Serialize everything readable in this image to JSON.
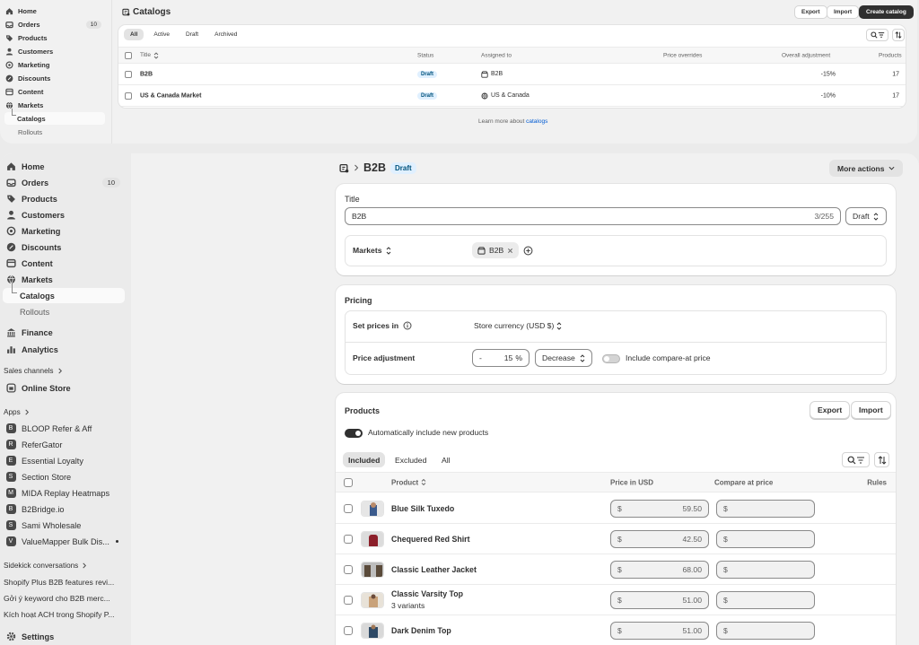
{
  "top": {
    "nav": {
      "home": "Home",
      "orders": "Orders",
      "orders_badge": "10",
      "products": "Products",
      "customers": "Customers",
      "marketing": "Marketing",
      "discounts": "Discounts",
      "content": "Content",
      "markets": "Markets",
      "catalogs": "Catalogs",
      "rollouts": "Rollouts"
    },
    "page_title": "Catalogs",
    "buttons": {
      "export": "Export",
      "import": "Import",
      "create": "Create catalog"
    },
    "tabs": [
      "All",
      "Active",
      "Draft",
      "Archived"
    ],
    "columns": {
      "title": "Title",
      "status": "Status",
      "assigned": "Assigned to",
      "overrides": "Price overrides",
      "adjustment": "Overall adjustment",
      "products": "Products"
    },
    "rows": [
      {
        "title": "B2B",
        "status": "Draft",
        "assigned": "B2B",
        "adjustment": "-15%",
        "products": "17"
      },
      {
        "title": "US & Canada Market",
        "status": "Draft",
        "assigned": "US & Canada",
        "adjustment": "-10%",
        "products": "17"
      }
    ],
    "learn_prefix": "Learn more about",
    "learn_link": "catalogs"
  },
  "sidebar": {
    "home": "Home",
    "orders": "Orders",
    "orders_badge": "10",
    "products": "Products",
    "customers": "Customers",
    "marketing": "Marketing",
    "discounts": "Discounts",
    "content": "Content",
    "markets": "Markets",
    "catalogs": "Catalogs",
    "rollouts": "Rollouts",
    "finance": "Finance",
    "analytics": "Analytics",
    "sales_channels": "Sales channels",
    "online_store": "Online Store",
    "apps": "Apps",
    "app_list": [
      "BLOOP Refer & Aff",
      "ReferGator",
      "Essential Loyalty",
      "Section Store",
      "MIDA Replay Heatmaps",
      "B2Bridge.io",
      "Sami Wholesale",
      "ValueMapper Bulk Dis..."
    ],
    "app_icons": [
      "B",
      "R",
      "E",
      "S",
      "M",
      "B",
      "S",
      "V"
    ],
    "sidekick": "Sidekick conversations",
    "conversations": [
      "Shopify Plus B2B features revi...",
      "Gởi ý keyword cho B2B merc...",
      "Kích hoạt ACH trong Shopify P..."
    ],
    "settings": "Settings"
  },
  "detail": {
    "breadcrumb_title": "B2B",
    "status_badge": "Draft",
    "more_actions": "More actions",
    "title_card": {
      "label": "Title",
      "value": "B2B",
      "counter": "3/255",
      "status_select": "Draft",
      "markets_label": "Markets",
      "market_chip": "B2B"
    },
    "pricing": {
      "heading": "Pricing",
      "set_prices_label": "Set prices in",
      "currency": "Store currency (USD $)",
      "adjustment_label": "Price adjustment",
      "sign": "-",
      "percent_value": "15",
      "percent_symbol": "%",
      "direction": "Decrease",
      "compare_label": "Include compare-at price"
    },
    "products": {
      "heading": "Products",
      "export": "Export",
      "import": "Import",
      "auto_include": "Automatically include new products",
      "tabs": [
        "Included",
        "Excluded",
        "All"
      ],
      "columns": {
        "product": "Product",
        "price": "Price in USD",
        "compare": "Compare at price",
        "rules": "Rules"
      },
      "currency_symbol": "$",
      "rows": [
        {
          "name": "Blue Silk Tuxedo",
          "variants": "",
          "price": "59.50",
          "thumb_color": "#3a5a8c"
        },
        {
          "name": "Chequered Red Shirt",
          "variants": "",
          "price": "42.50",
          "thumb_color": "#8c1f2a"
        },
        {
          "name": "Classic Leather Jacket",
          "variants": "",
          "price": "68.00",
          "thumb_color": "#5a4a3a"
        },
        {
          "name": "Classic Varsity Top",
          "variants": "3 variants",
          "price": "51.00",
          "thumb_color": "#c9a27a"
        },
        {
          "name": "Dark Denim Top",
          "variants": "",
          "price": "51.00",
          "thumb_color": "#2f4a66"
        }
      ]
    }
  },
  "colors": {
    "accent_link": "#005bd3",
    "draft_badge_bg": "#e0f0ff",
    "draft_badge_text": "#00527c",
    "dark_button": "#303030"
  }
}
